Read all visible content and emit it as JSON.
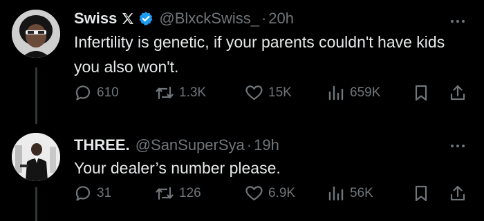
{
  "tweets": [
    {
      "display_name": "Swiss",
      "has_x_badge": true,
      "has_verified_badge": true,
      "handle": "@BlxckSwiss_",
      "separator": "·",
      "time": "20h",
      "text": "Infertility is genetic, if your parents couldn't have kids you also won't.",
      "replies": "610",
      "retweets": "1.3K",
      "likes": "15K",
      "views": "659K"
    },
    {
      "display_name": "THREE.",
      "has_x_badge": false,
      "has_verified_badge": false,
      "handle": "@SanSuperSya",
      "separator": "·",
      "time": "19h",
      "text": "Your dealer’s number please.",
      "replies": "31",
      "retweets": "126",
      "likes": "6.9K",
      "views": "56K"
    }
  ],
  "colors": {
    "background": "#000000",
    "primary_text": "#e7e9ea",
    "secondary_text": "#71767b",
    "verified_blue": "#1d9bf0",
    "thread_line": "#333639"
  },
  "icons": [
    "reply-icon",
    "retweet-icon",
    "like-icon",
    "views-icon",
    "bookmark-icon",
    "share-icon",
    "x-logo-icon",
    "verified-badge-icon",
    "more-icon"
  ]
}
